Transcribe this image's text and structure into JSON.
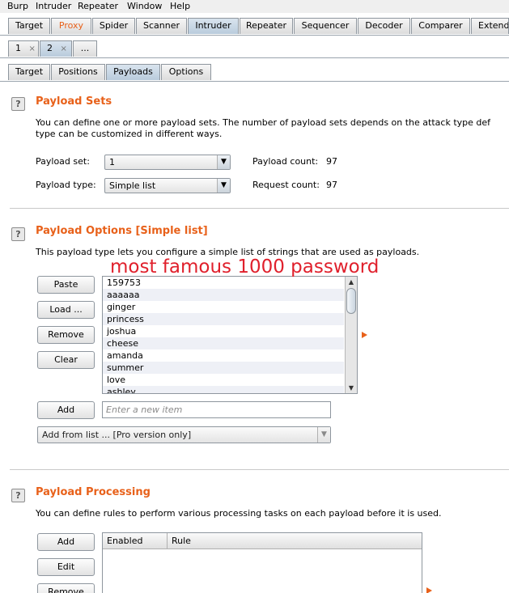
{
  "menubar": {
    "items": [
      "Burp",
      "Intruder",
      "Repeater",
      "Window",
      "Help"
    ]
  },
  "main_tabs": [
    "Target",
    "Proxy",
    "Spider",
    "Scanner",
    "Intruder",
    "Repeater",
    "Sequencer",
    "Decoder",
    "Comparer",
    "Extend"
  ],
  "attack_tabs": {
    "items": [
      "1",
      "2"
    ],
    "close_glyph": "×",
    "more": "..."
  },
  "sub_tabs": [
    "Target",
    "Positions",
    "Payloads",
    "Options"
  ],
  "payload_sets": {
    "help": "?",
    "title": "Payload Sets",
    "description_line1": "You can define one or more payload sets. The number of payload sets depends on the attack type def",
    "description_line2": "type can be customized in different ways.",
    "set_label": "Payload set:",
    "set_value": "1",
    "type_label": "Payload type:",
    "type_value": "Simple list",
    "count_label": "Payload count:",
    "count_value": "97",
    "request_label": "Request count:",
    "request_value": "97"
  },
  "payload_options": {
    "help": "?",
    "title": "Payload Options [Simple list]",
    "description": "This payload type lets you configure a simple list of strings that are used as payloads.",
    "buttons": {
      "paste": "Paste",
      "load": "Load ...",
      "remove": "Remove",
      "clear": "Clear",
      "add": "Add"
    },
    "list": [
      "159753",
      "aaaaaa",
      "ginger",
      "princess",
      "joshua",
      "cheese",
      "amanda",
      "summer",
      "love",
      "ashley"
    ],
    "new_item_placeholder": "Enter a new item",
    "add_from_list": "Add from list ... [Pro version only]",
    "annotation": "most famous 1000 password"
  },
  "payload_processing": {
    "help": "?",
    "title": "Payload Processing",
    "description": "You can define rules to perform various processing tasks on each payload before it is used.",
    "buttons": {
      "add": "Add",
      "edit": "Edit",
      "remove": "Remove"
    },
    "columns": [
      "Enabled",
      "Rule"
    ]
  },
  "colors": {
    "accent": "#e8611a",
    "annotation": "#e0202c",
    "tab_active": "#c5d5e4"
  }
}
